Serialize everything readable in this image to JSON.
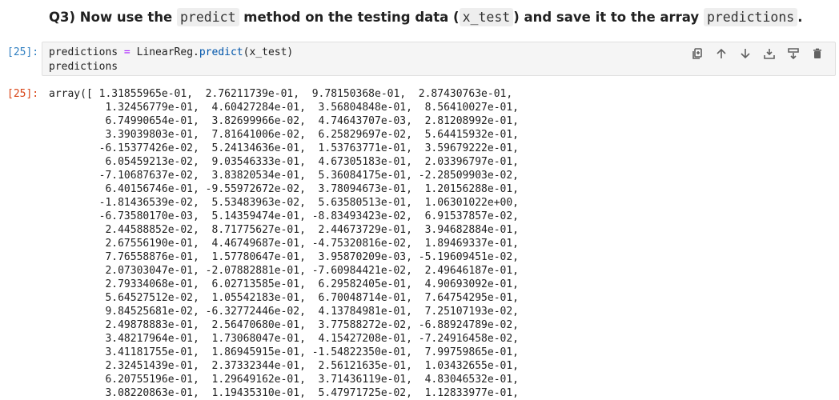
{
  "markdown": {
    "part1": "Q3) Now use the ",
    "code1": "predict",
    "part2": " method on the testing data (",
    "code2": "x_test",
    "part3": ") and save it to the array ",
    "code3": "predictions",
    "part4": "."
  },
  "cell": {
    "in_prompt": "[25]:",
    "out_prompt": "[25]:",
    "code": {
      "line1_var": "predictions ",
      "line1_op": "=",
      "line1_obj": " LinearReg.",
      "line1_method": "predict",
      "line1_args": "(x_test)",
      "line2": "predictions"
    },
    "toolbar": {
      "duplicate": "copy-icon",
      "move_up": "arrow-up-icon",
      "move_down": "arrow-down-icon",
      "insert_above": "insert-above-icon",
      "insert_below": "insert-below-icon",
      "delete": "trash-icon"
    },
    "output_lines": [
      "array([ 1.31855965e-01,  2.76211739e-01,  9.78150368e-01,  2.87430763e-01,",
      "         1.32456779e-01,  4.60427284e-01,  3.56804848e-01,  8.56410027e-01,",
      "         6.74990654e-01,  3.82699966e-02,  4.74643707e-03,  2.81208992e-01,",
      "         3.39039803e-01,  7.81641006e-02,  6.25829697e-02,  5.64415932e-01,",
      "        -6.15377426e-02,  5.24134636e-01,  1.53763771e-01,  3.59679222e-01,",
      "         6.05459213e-02,  9.03546333e-01,  4.67305183e-01,  2.03396797e-01,",
      "        -7.10687637e-02,  3.83820534e-01,  5.36084175e-01, -2.28509903e-02,",
      "         6.40156746e-01, -9.55972672e-02,  3.78094673e-01,  1.20156288e-01,",
      "        -1.81436539e-02,  5.53483963e-02,  5.63580513e-01,  1.06301022e+00,",
      "        -6.73580170e-03,  5.14359474e-01, -8.83493423e-02,  6.91537857e-02,",
      "         2.44588852e-02,  8.71775627e-01,  2.44673729e-01,  3.94682884e-01,",
      "         2.67556190e-01,  4.46749687e-01, -4.75320816e-02,  1.89469337e-01,",
      "         7.76558876e-01,  1.57780647e-01,  3.95870209e-03, -5.19609451e-02,",
      "         2.07303047e-01, -2.07882881e-01, -7.60984421e-02,  2.49646187e-01,",
      "         2.79334068e-01,  6.02713585e-01,  6.29582405e-01,  4.90693092e-01,",
      "         5.64527512e-02,  1.05542183e-01,  6.70048714e-01,  7.64754295e-01,",
      "         9.84525681e-02, -6.32772446e-02,  4.13784981e-01,  7.25107193e-02,",
      "         2.49878883e-01,  2.56470680e-01,  3.77588272e-02, -6.88924789e-02,",
      "         3.48217964e-01,  1.73068047e-01,  4.15427208e-01, -7.24916458e-02,",
      "         3.41181755e-01,  1.86945915e-01, -1.54822350e-01,  7.99759865e-01,",
      "         2.32451439e-01,  2.37332344e-01,  2.56121635e-01,  1.03432655e-01,",
      "         6.20755196e-01,  1.29649162e-01,  3.71436119e-01,  4.83046532e-01,",
      "         3.08220863e-01,  1.19435310e-01,  5.47971725e-02,  1.12833977e-01,"
    ]
  }
}
